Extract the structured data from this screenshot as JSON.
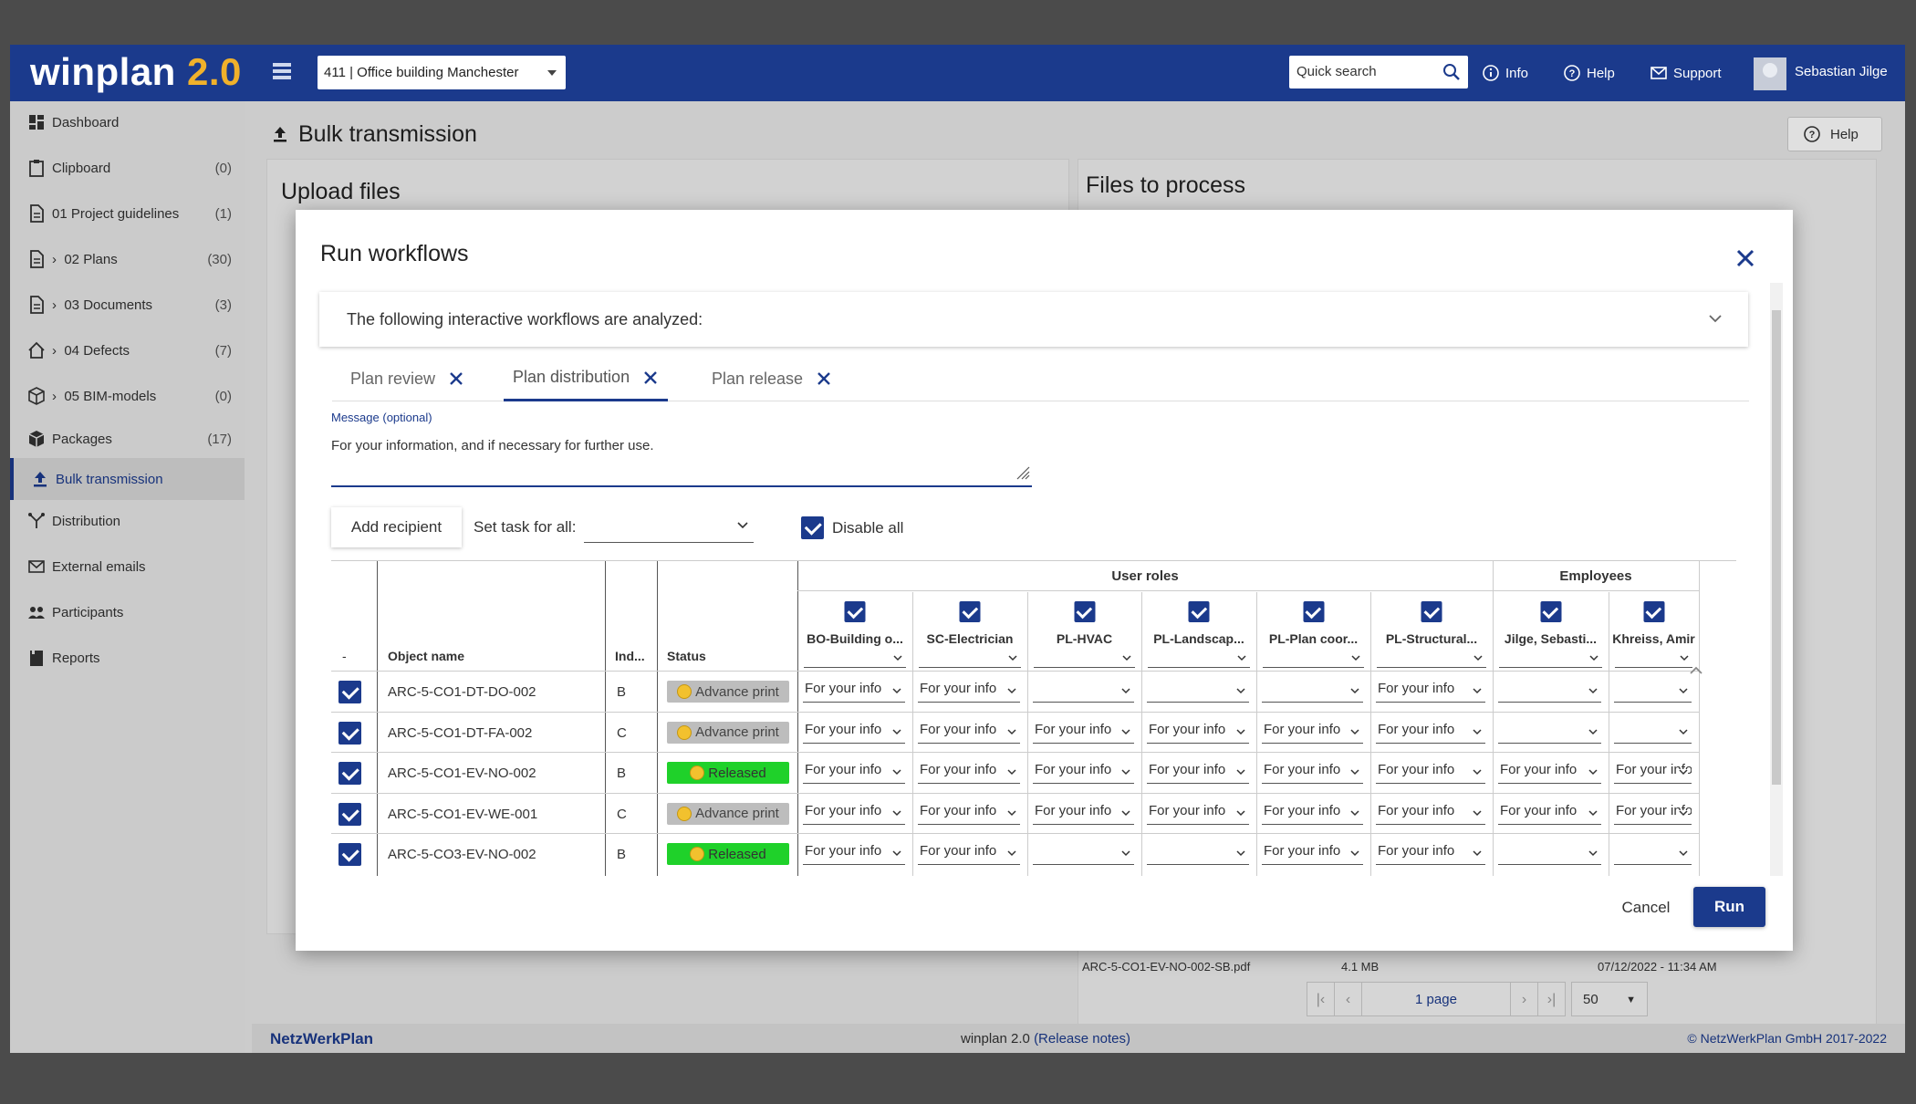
{
  "app": {
    "logo_main": "winplan",
    "logo_version": "2.0",
    "project": "411 | Office building Manchester",
    "quick_search_placeholder": "Quick search",
    "info_label": "Info",
    "help_label": "Help",
    "support_label": "Support",
    "user_name": "Sebastian Jilge"
  },
  "sidebar": {
    "items": [
      {
        "label": "Dashboard",
        "count": ""
      },
      {
        "label": "Clipboard",
        "count": "(0)"
      },
      {
        "label": "01 Project guidelines",
        "count": "(1)"
      },
      {
        "label": "02 Plans",
        "count": "(30)"
      },
      {
        "label": "03 Documents",
        "count": "(3)"
      },
      {
        "label": "04 Defects",
        "count": "(7)"
      },
      {
        "label": "05 BIM-models",
        "count": "(0)"
      },
      {
        "label": "Packages",
        "count": "(17)"
      },
      {
        "label": "Bulk transmission",
        "count": ""
      },
      {
        "label": "Distribution",
        "count": ""
      },
      {
        "label": "External emails",
        "count": ""
      },
      {
        "label": "Participants",
        "count": ""
      },
      {
        "label": "Reports",
        "count": ""
      }
    ]
  },
  "page": {
    "title": "Bulk transmission",
    "help_label": "Help",
    "upload_title": "Upload files",
    "files_title": "Files to process",
    "bg_file_name": "ARC-5-CO1-EV-NO-002-SB.pdf",
    "bg_file_size": "4.1 MB",
    "bg_file_date": "07/12/2022 - 11:34 AM",
    "pager_label": "1 page",
    "page_size": "50"
  },
  "footer": {
    "brand": "NetzWerkPlan",
    "version": "winplan 2.0",
    "release_notes": "(Release notes)",
    "copyright": "© NetzWerkPlan GmbH 2017-2022"
  },
  "modal": {
    "title": "Run workflows",
    "analyzed_text": "The following interactive workflows are analyzed:",
    "tabs": [
      {
        "label": "Plan review"
      },
      {
        "label": "Plan distribution"
      },
      {
        "label": "Plan release"
      }
    ],
    "message_label": "Message (optional)",
    "message_value": "For your information, and if necessary for further use.",
    "add_recipient": "Add recipient",
    "set_task_label": "Set task for all:",
    "disable_all": "Disable all",
    "groups": {
      "user_roles": "User roles",
      "employees": "Employees"
    },
    "columns": {
      "check": "-",
      "object": "Object name",
      "index": "Ind...",
      "status": "Status"
    },
    "role_columns": [
      "BO-Building o...",
      "SC-Electrician",
      "PL-HVAC",
      "PL-Landscap...",
      "PL-Plan coor...",
      "PL-Structural...",
      "Jilge, Sebasti...",
      "Khreiss, Amir"
    ],
    "rows": [
      {
        "object": "ARC-5-CO1-DT-DO-002",
        "index": "B",
        "status": "Advance print",
        "status_type": "adv",
        "cells": [
          "For your info",
          "For your info",
          "",
          "",
          "",
          "For your info",
          "",
          ""
        ]
      },
      {
        "object": "ARC-5-CO1-DT-FA-002",
        "index": "C",
        "status": "Advance print",
        "status_type": "adv",
        "cells": [
          "For your info",
          "For your info",
          "For your info",
          "For your info",
          "For your info",
          "For your info",
          "",
          ""
        ]
      },
      {
        "object": "ARC-5-CO1-EV-NO-002",
        "index": "B",
        "status": "Released",
        "status_type": "rel",
        "cells": [
          "For your info",
          "For your info",
          "For your info",
          "For your info",
          "For your info",
          "For your info",
          "For your info",
          "For your info"
        ]
      },
      {
        "object": "ARC-5-CO1-EV-WE-001",
        "index": "C",
        "status": "Advance print",
        "status_type": "adv",
        "cells": [
          "For your info",
          "For your info",
          "For your info",
          "For your info",
          "For your info",
          "For your info",
          "For your info",
          "For your info"
        ]
      },
      {
        "object": "ARC-5-CO3-EV-NO-002",
        "index": "B",
        "status": "Released",
        "status_type": "rel",
        "cells": [
          "For your info",
          "For your info",
          "",
          "",
          "For your info",
          "For your info",
          "",
          ""
        ]
      }
    ],
    "cancel": "Cancel",
    "run": "Run"
  },
  "colors": {
    "brand": "#1b3a8c",
    "accent": "#f0b12b",
    "released": "#1fd12a",
    "advance": "#bdbdbd"
  }
}
